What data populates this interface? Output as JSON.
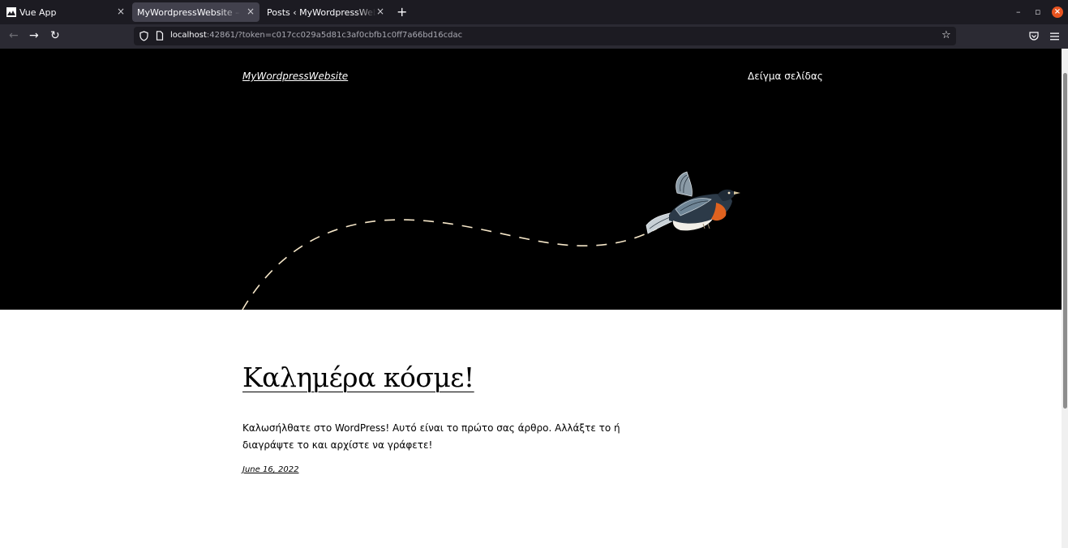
{
  "browser": {
    "tabs": [
      {
        "label": "Vue App",
        "close": "×"
      },
      {
        "label": "MyWordpressWebsite – Άλλο ένα ιστολόγιο",
        "close": "×"
      },
      {
        "label": "Posts ‹ MyWordpressWebsite — WordPress",
        "close": "×"
      }
    ],
    "new_tab": "+",
    "window_controls": {
      "minimize": "–",
      "restore": "▫",
      "close": "×"
    },
    "nav": {
      "back": "←",
      "forward": "→",
      "reload": "↻"
    },
    "url": {
      "host": "localhost",
      "rest": ":42861/?token=c017cc029a5d81c3af0cbfb1c0ff7a66bd16cdac"
    },
    "icons": {
      "shield": "shield-icon",
      "page": "page-icon",
      "star": "star-icon",
      "pocket": "pocket-icon",
      "menu": "hamburger-icon"
    },
    "accent": "#e95420"
  },
  "site": {
    "title": "MyWordpressWebsite",
    "nav_link": "Δείγμα σελίδας",
    "hero_background": "#000000"
  },
  "post": {
    "title": "Καλημέρα κόσμε!",
    "excerpt": "Καλωσήλθατε στο WordPress! Αυτό είναι το πρώτο σας άρθρο. Αλλάξτε το ή διαγράψτε το και αρχίστε να γράφετε!",
    "date": "June 16, 2022"
  }
}
